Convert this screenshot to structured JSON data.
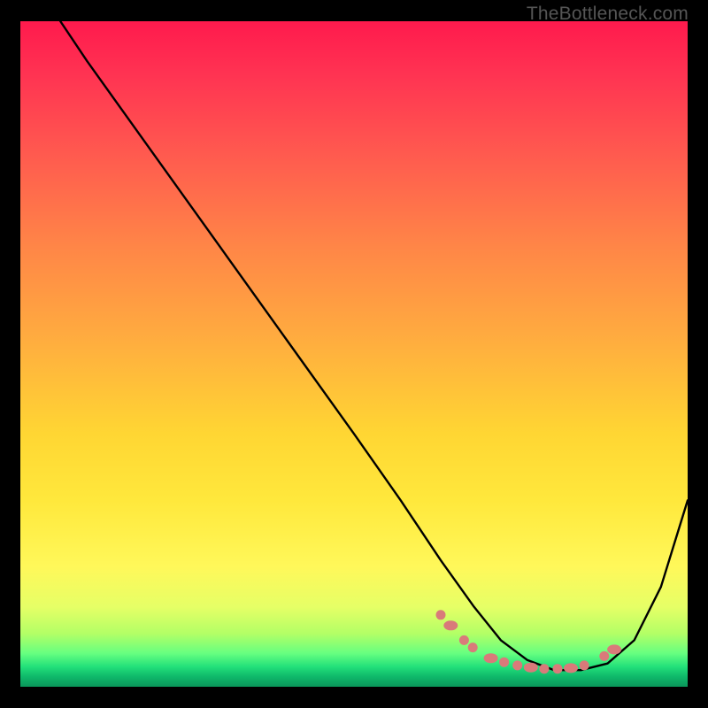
{
  "watermark": "TheBottleneck.com",
  "chart_data": {
    "type": "line",
    "title": "",
    "xlabel": "",
    "ylabel": "",
    "xlim": [
      0,
      100
    ],
    "ylim": [
      0,
      100
    ],
    "series": [
      {
        "name": "curve",
        "x": [
          6,
          10,
          20,
          30,
          40,
          50,
          57,
          63,
          68,
          72,
          76,
          80,
          84,
          88,
          92,
          96,
          100
        ],
        "y": [
          100,
          94,
          80,
          66,
          52,
          38,
          28,
          19,
          12,
          7,
          4,
          2.5,
          2.5,
          3.5,
          7,
          15,
          28
        ]
      }
    ],
    "markers": {
      "name": "dotted-cluster",
      "color": "#d97a7a",
      "points_xy": [
        [
          63,
          10.8
        ],
        [
          64.5,
          9.2
        ],
        [
          66.5,
          7.0
        ],
        [
          67.8,
          5.9
        ],
        [
          70.5,
          4.3
        ],
        [
          72.5,
          3.7
        ],
        [
          74.5,
          3.2
        ],
        [
          76.5,
          2.9
        ],
        [
          78.5,
          2.7
        ],
        [
          80.5,
          2.7
        ],
        [
          82.5,
          2.8
        ],
        [
          84.5,
          3.2
        ],
        [
          87.5,
          4.6
        ],
        [
          89,
          5.6
        ]
      ]
    }
  }
}
